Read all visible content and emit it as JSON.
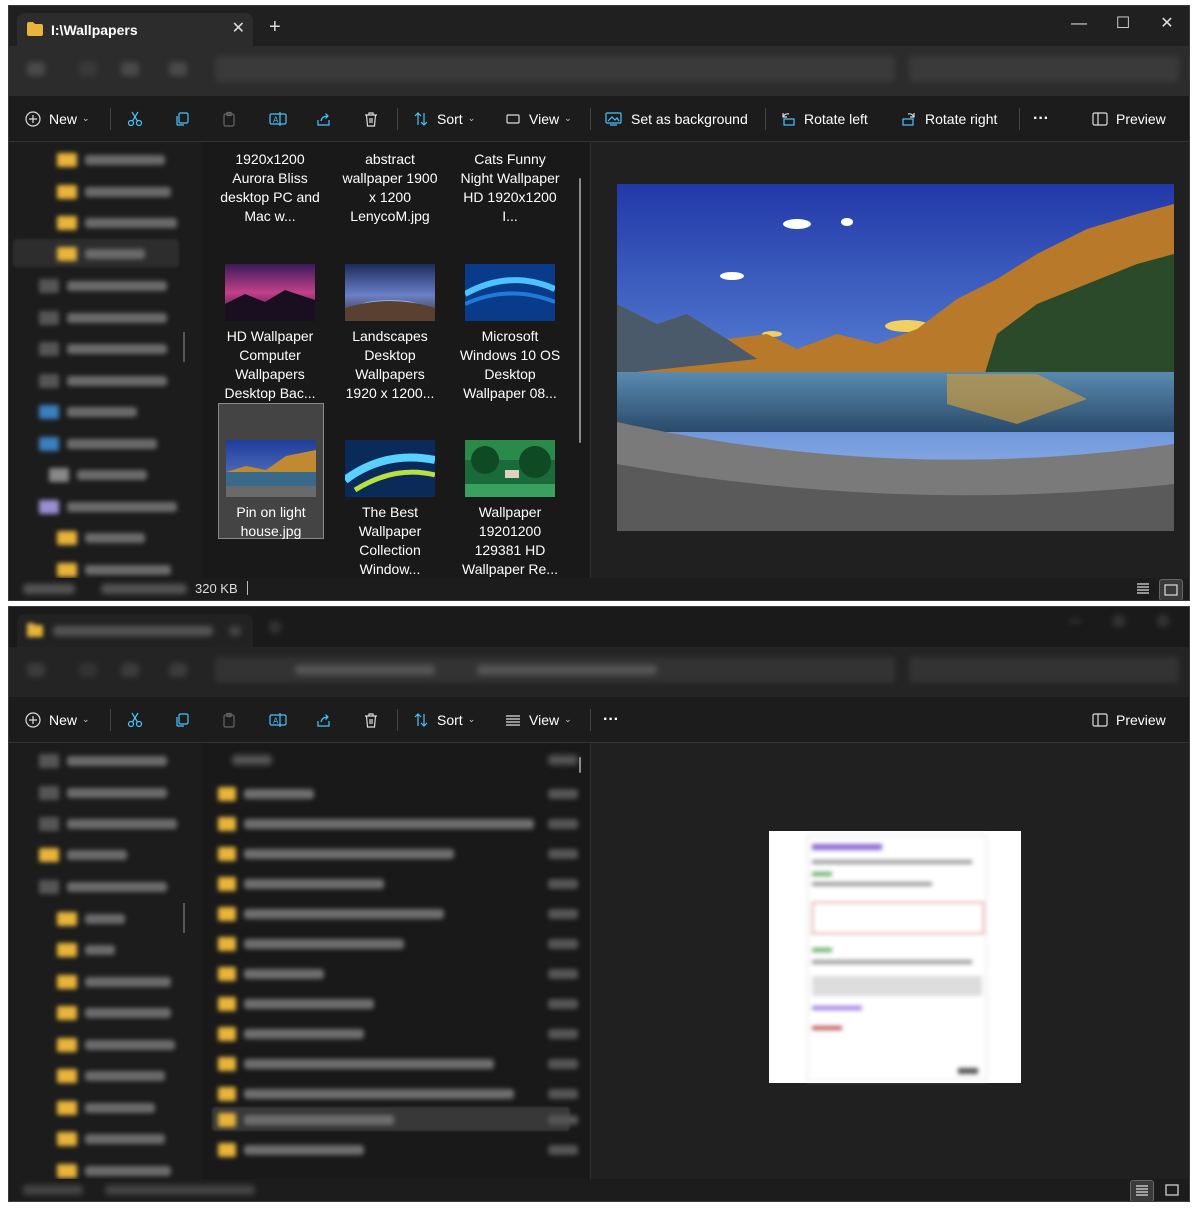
{
  "window1": {
    "tab": {
      "title": "I:\\Wallpapers"
    },
    "toolbar": {
      "new_label": "New",
      "sort_label": "Sort",
      "view_label": "View",
      "set_background_label": "Set as background",
      "rotate_left_label": "Rotate left",
      "rotate_right_label": "Rotate right",
      "more_label": "···",
      "preview_label": "Preview"
    },
    "files": [
      {
        "name": "1920x1200 Aurora Bliss desktop PC and Mac w..."
      },
      {
        "name": "abstract wallpaper 1900 x 1200 LenycoM.jpg"
      },
      {
        "name": "Cats Funny Night Wallpaper HD 1920x1200 I..."
      },
      {
        "name": "HD Wallpaper Computer Wallpapers Desktop Bac..."
      },
      {
        "name": "Landscapes Desktop Wallpapers 1920 x 1200..."
      },
      {
        "name": "Microsoft Windows 10 OS Desktop Wallpaper 08..."
      },
      {
        "name": "Pin on light house.jpg",
        "selected": true
      },
      {
        "name": "The Best Wallpaper Collection Window..."
      },
      {
        "name": "Wallpaper 19201200 129381 HD Wallpaper Re..."
      }
    ],
    "status": {
      "size": "320 KB"
    }
  },
  "window2": {
    "toolbar": {
      "new_label": "New",
      "sort_label": "Sort",
      "view_label": "View",
      "more_label": "···",
      "preview_label": "Preview"
    }
  },
  "colors": {
    "accent": "#4cc2ff",
    "folder": "#e8b43a",
    "background": "#1c1c1c"
  }
}
